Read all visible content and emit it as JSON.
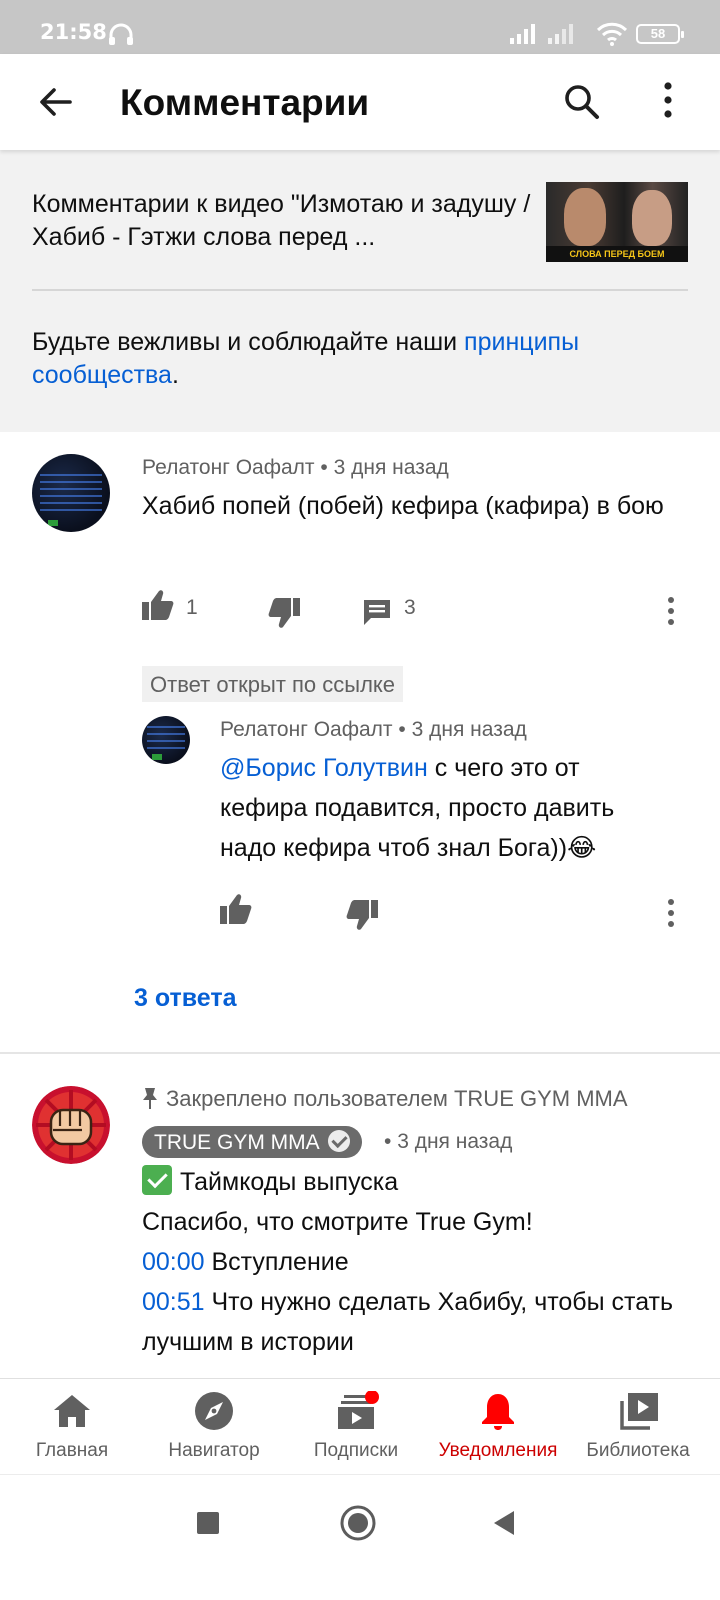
{
  "status_bar": {
    "time": "21:58",
    "battery": "58"
  },
  "app_bar": {
    "title": "Комментарии"
  },
  "header": {
    "video_title": "Комментарии к видео \"Измотаю и задушу / Хабиб - Гэтжи слова перед ...",
    "thumbnail_caption": "СЛОВА ПЕРЕД БОЕМ",
    "polite_prefix": "Будьте вежливы и соблюдайте наши ",
    "polite_link": "принципы сообщества",
    "polite_suffix": "."
  },
  "comments": [
    {
      "author": "Релатонг Оафалт",
      "time": "3 дня назад",
      "text": "Хабиб попей (побей) кефира (кафира) в бою",
      "likes": "1",
      "replies": "3"
    }
  ],
  "linked_reply_badge": "Ответ открыт по ссылке",
  "reply": {
    "author": "Релатонг Оафалт",
    "time": "3 дня назад",
    "mention": "@Борис Голутвин",
    "text": " с чего это от кефира подавится, просто давить надо кефира чтоб знал Бога))",
    "emoji": "😂"
  },
  "replies_link": "3 ответа",
  "pinned_comment": {
    "pinned_by": "Закреплено пользователем TRUE GYM MMA",
    "channel": "TRUE GYM MMA",
    "time": "3 дня назад",
    "line1": "Таймкоды выпуска",
    "line2": "Спасибо, что смотрите True Gym!",
    "ts1": "00:00",
    "ts1_text": " Вступление",
    "ts2": "00:51",
    "ts2_text": " Что нужно сделать Хабибу, чтобы стать лучшим в истории"
  },
  "bottom_nav": [
    {
      "label": "Главная",
      "icon": "home-icon",
      "active": false
    },
    {
      "label": "Навигатор",
      "icon": "compass-icon",
      "active": false
    },
    {
      "label": "Подписки",
      "icon": "subscriptions-icon",
      "active": false,
      "badge": true
    },
    {
      "label": "Уведомления",
      "icon": "bell-icon",
      "active": true
    },
    {
      "label": "Библиотека",
      "icon": "library-icon",
      "active": false
    }
  ],
  "colors": {
    "link": "#065fd4",
    "active_nav": "#cc0000",
    "secondary_text": "#606060"
  }
}
